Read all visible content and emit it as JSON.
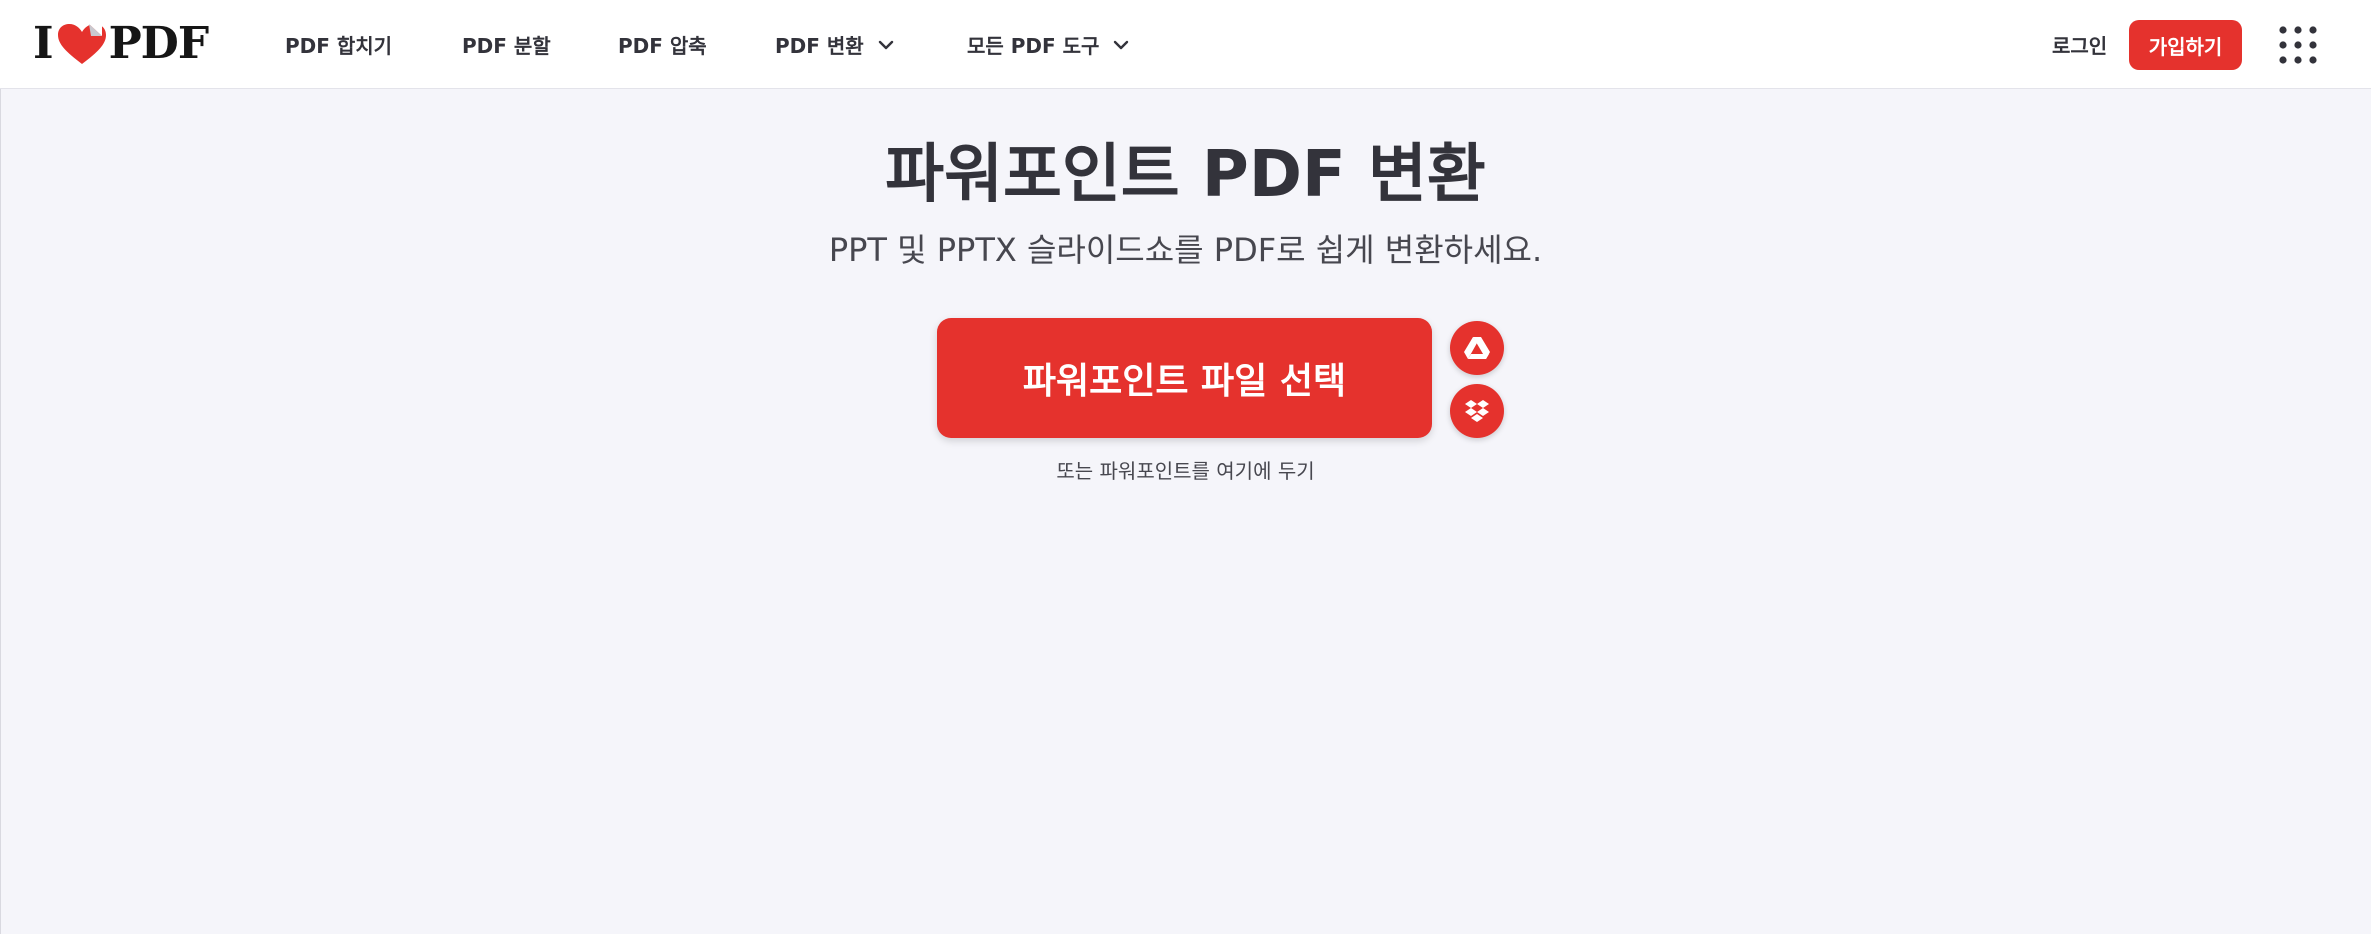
{
  "logo": {
    "text_i": "I",
    "text_pdf": "PDF",
    "icon": "heart-icon"
  },
  "nav": {
    "items": [
      {
        "label": "PDF 합치기"
      },
      {
        "label": "PDF 분할"
      },
      {
        "label": "PDF 압축"
      },
      {
        "label": "PDF 변환",
        "icon": "chevron-down-icon"
      },
      {
        "label": "모든 PDF 도구",
        "icon": "chevron-down-icon"
      }
    ],
    "login_label": "로그인",
    "signup_label": "가입하기",
    "apps_icon": "grid-dots-icon"
  },
  "hero": {
    "title": "파워포인트 PDF 변환",
    "subtitle": "PPT 및 PPTX 슬라이드쇼를 PDF로 쉽게 변환하세요.",
    "select_button_label": "파워포인트 파일 선택",
    "drop_hint": "또는 파워포인트를 여기에 두기",
    "cloud_buttons": [
      {
        "icon": "google-drive-icon"
      },
      {
        "icon": "dropbox-icon"
      }
    ]
  },
  "colors": {
    "accent": "#e5322d",
    "text": "#33333b",
    "background": "#f5f5fa",
    "header_background": "#ffffff"
  }
}
